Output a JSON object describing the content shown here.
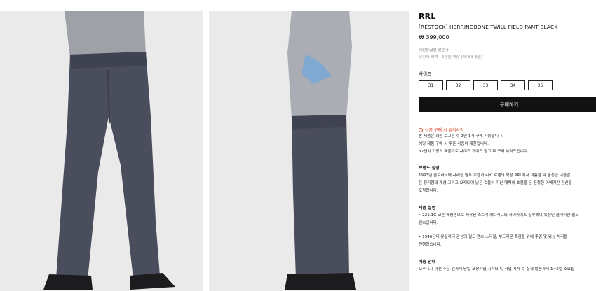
{
  "product": {
    "brand": "RRL",
    "name": "[RESTOCK] HERRINGBONE TWILL FIELD PANT BLACK",
    "price": "₩ 399,000"
  },
  "benefits": [
    "회원등급별 할인가",
    "무이자 혜택 : 5만원 이상 (최대 8개월)"
  ],
  "size_section": {
    "title": "사이즈",
    "options": [
      "31",
      "32",
      "33",
      "34",
      "36"
    ]
  },
  "buy_label": "구매하기",
  "notice": {
    "title": "상품 구매 시 유의사항",
    "lines": [
      "본 제품은 회원 로그인 후 1인 1개 구매 가능합니다.",
      "해당 제품 구매 시 쿠폰 사용이 제한됩니다.",
      "32인치 기장의 제품으로 사이즈 가이드 참고 후 구매 부탁드립니다."
    ]
  },
  "brand_desc": {
    "title": "브랜드 설명",
    "lines": [
      "1993년 콜로라도에 자리한 랄프 로렌과 리키 로렌의 목장 RRL에서 이름을 따 론칭한 더블알",
      "은 정직함과 개성 그리고 오래되어 낡은 것들이 지닌 매력에 초점을 둔 진정한 아메리칸 정신을",
      "포착합니다."
    ]
  },
  "product_desc": {
    "title": "제품 설명",
    "lines": [
      "• 221.1G 코튼 헤링본으로 제작된 스트레이트 레그와 하이라이즈 실루엣이 특징인 클래식한 필드",
      "팬츠입니다.",
      "",
      "• 1940년대 유틸리티 감성의 필드 팬츠 스타일, 부드러운 촉감을 위해 후염 및 워싱 처리를",
      "진행했습니다."
    ]
  },
  "shipping": {
    "title": "배송 안내",
    "lines": [
      "오후 1시 이전 주문 건까지 당일 포장작업 시작되며, 작업 시작 후 실제 발송까지 1~2일 소요됩"
    ]
  }
}
